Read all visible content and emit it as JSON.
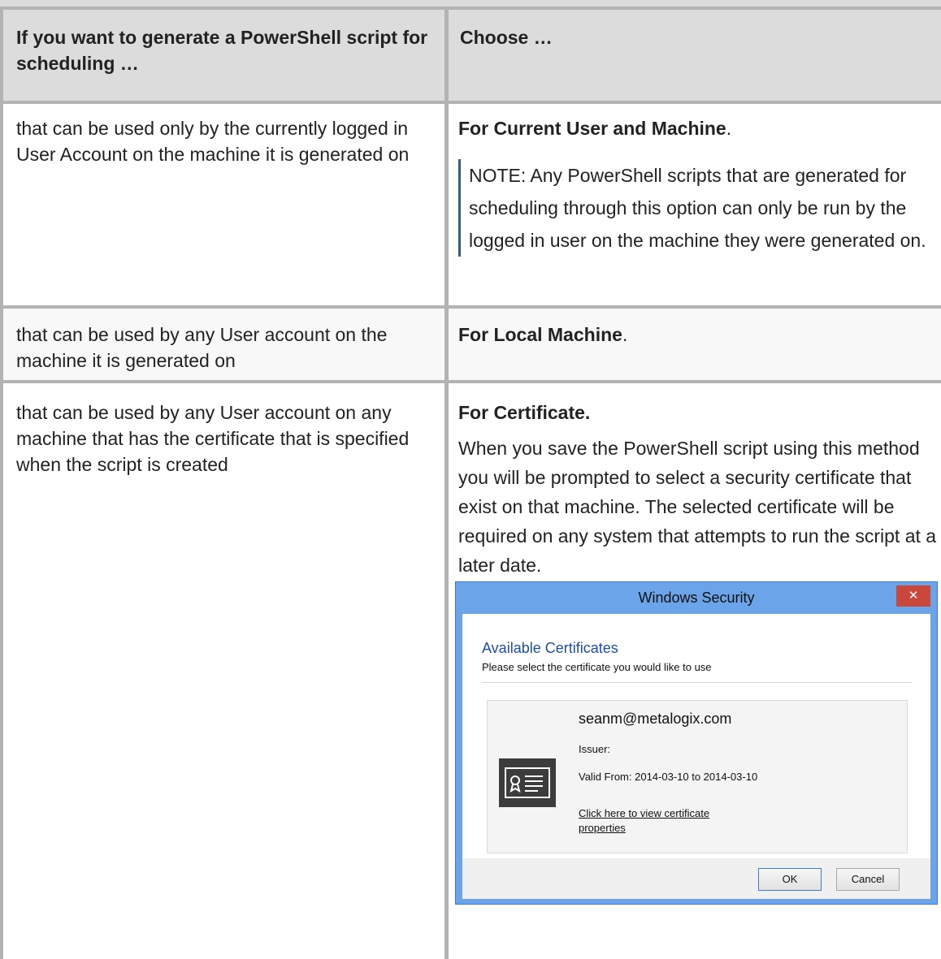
{
  "table": {
    "header": {
      "col1": "If you want to generate a PowerShell script for scheduling …",
      "col2": "Choose …"
    },
    "rows": [
      {
        "condition": "that can be used only by the currently logged in User Account on the machine it is generated on",
        "choice": "For Current User and Machine",
        "choice_suffix": ".",
        "note": "NOTE: Any PowerShell scripts that are generated for scheduling through this option can only be run by the logged in user on the machine they were generated on."
      },
      {
        "condition": "that can be used by any User account on the machine it is generated on",
        "choice": "For Local Machine",
        "choice_suffix": "."
      },
      {
        "condition": "that can be used by any User account on any machine that has the certificate that is specified when the script is created",
        "choice": "For Certificate.",
        "description": "When you save the PowerShell script using this method you will be prompted to select a security certificate that exist on that machine. The selected certificate will be required on any system that attempts to run the script at a later date."
      }
    ]
  },
  "dialog": {
    "title": "Windows Security",
    "close_symbol": "✕",
    "heading": "Available Certificates",
    "subheading": "Please select the certificate you would like to use",
    "certificate": {
      "email": "seanm@metalogix.com",
      "issuer_label": "Issuer:",
      "valid_from": "Valid From: 2014-03-10 to 2014-03-10",
      "link": "Click here to view certificate properties",
      "icon": "certificate-icon"
    },
    "ok_label": "OK",
    "cancel_label": "Cancel"
  },
  "colors": {
    "grid": "#b3b3b3",
    "header_bg": "#dcdcdc",
    "dialog_frame": "#6ca4ea",
    "dialog_heading": "#1f4ea6",
    "close_button": "#c9483b",
    "note_bar": "#2f5f7b"
  }
}
